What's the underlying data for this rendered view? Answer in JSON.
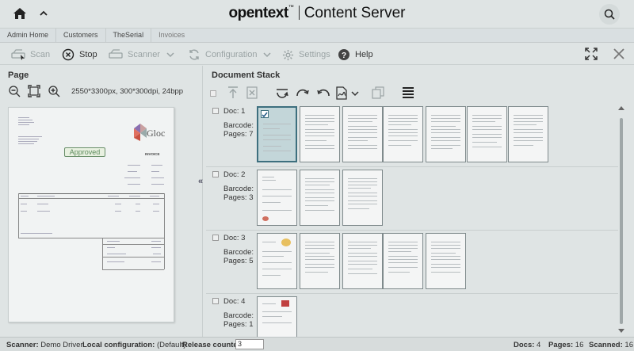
{
  "brand": {
    "name": "opentext",
    "trademark": "™",
    "product": "Content Server"
  },
  "breadcrumb": [
    "Admin Home",
    "Customers",
    "TheSerial",
    "Invoices"
  ],
  "toolbar": {
    "scan": "Scan",
    "stop": "Stop",
    "scanner": "Scanner",
    "configuration": "Configuration",
    "settings": "Settings",
    "help": "Help"
  },
  "page_panel": {
    "title": "Page",
    "info": "2550*3300px, 300*300dpi, 24bpp",
    "preview": {
      "logo_text": "Gloc",
      "stamp": "Approved",
      "heading": "INVOICE"
    }
  },
  "stack": {
    "title": "Document Stack",
    "docs": [
      {
        "name": "Doc: 1",
        "barcode": "Barcode:",
        "pages": "Pages: 7",
        "page_count": 7
      },
      {
        "name": "Doc: 2",
        "barcode": "Barcode:",
        "pages": "Pages: 3",
        "page_count": 3
      },
      {
        "name": "Doc: 3",
        "barcode": "Barcode:",
        "pages": "Pages: 5",
        "page_count": 5
      },
      {
        "name": "Doc: 4",
        "barcode": "Barcode:",
        "pages": "Pages: 1",
        "page_count": 1
      }
    ]
  },
  "status": {
    "scanner_label": "Scanner:",
    "scanner_value": "Demo Driver",
    "local_config_label": "Local configuration:",
    "local_config_value": "(Default)",
    "release_counter_label": "Release counter:",
    "release_counter_value": "3",
    "docs_label": "Docs:",
    "docs_value": "4",
    "pages_label": "Pages:",
    "pages_value": "16",
    "scanned_label": "Scanned:",
    "scanned_value": "16"
  },
  "colors": {
    "background": "#dfe4e4",
    "selected_thumb": "#c3d6d9",
    "accent": "#3d6f7e"
  }
}
